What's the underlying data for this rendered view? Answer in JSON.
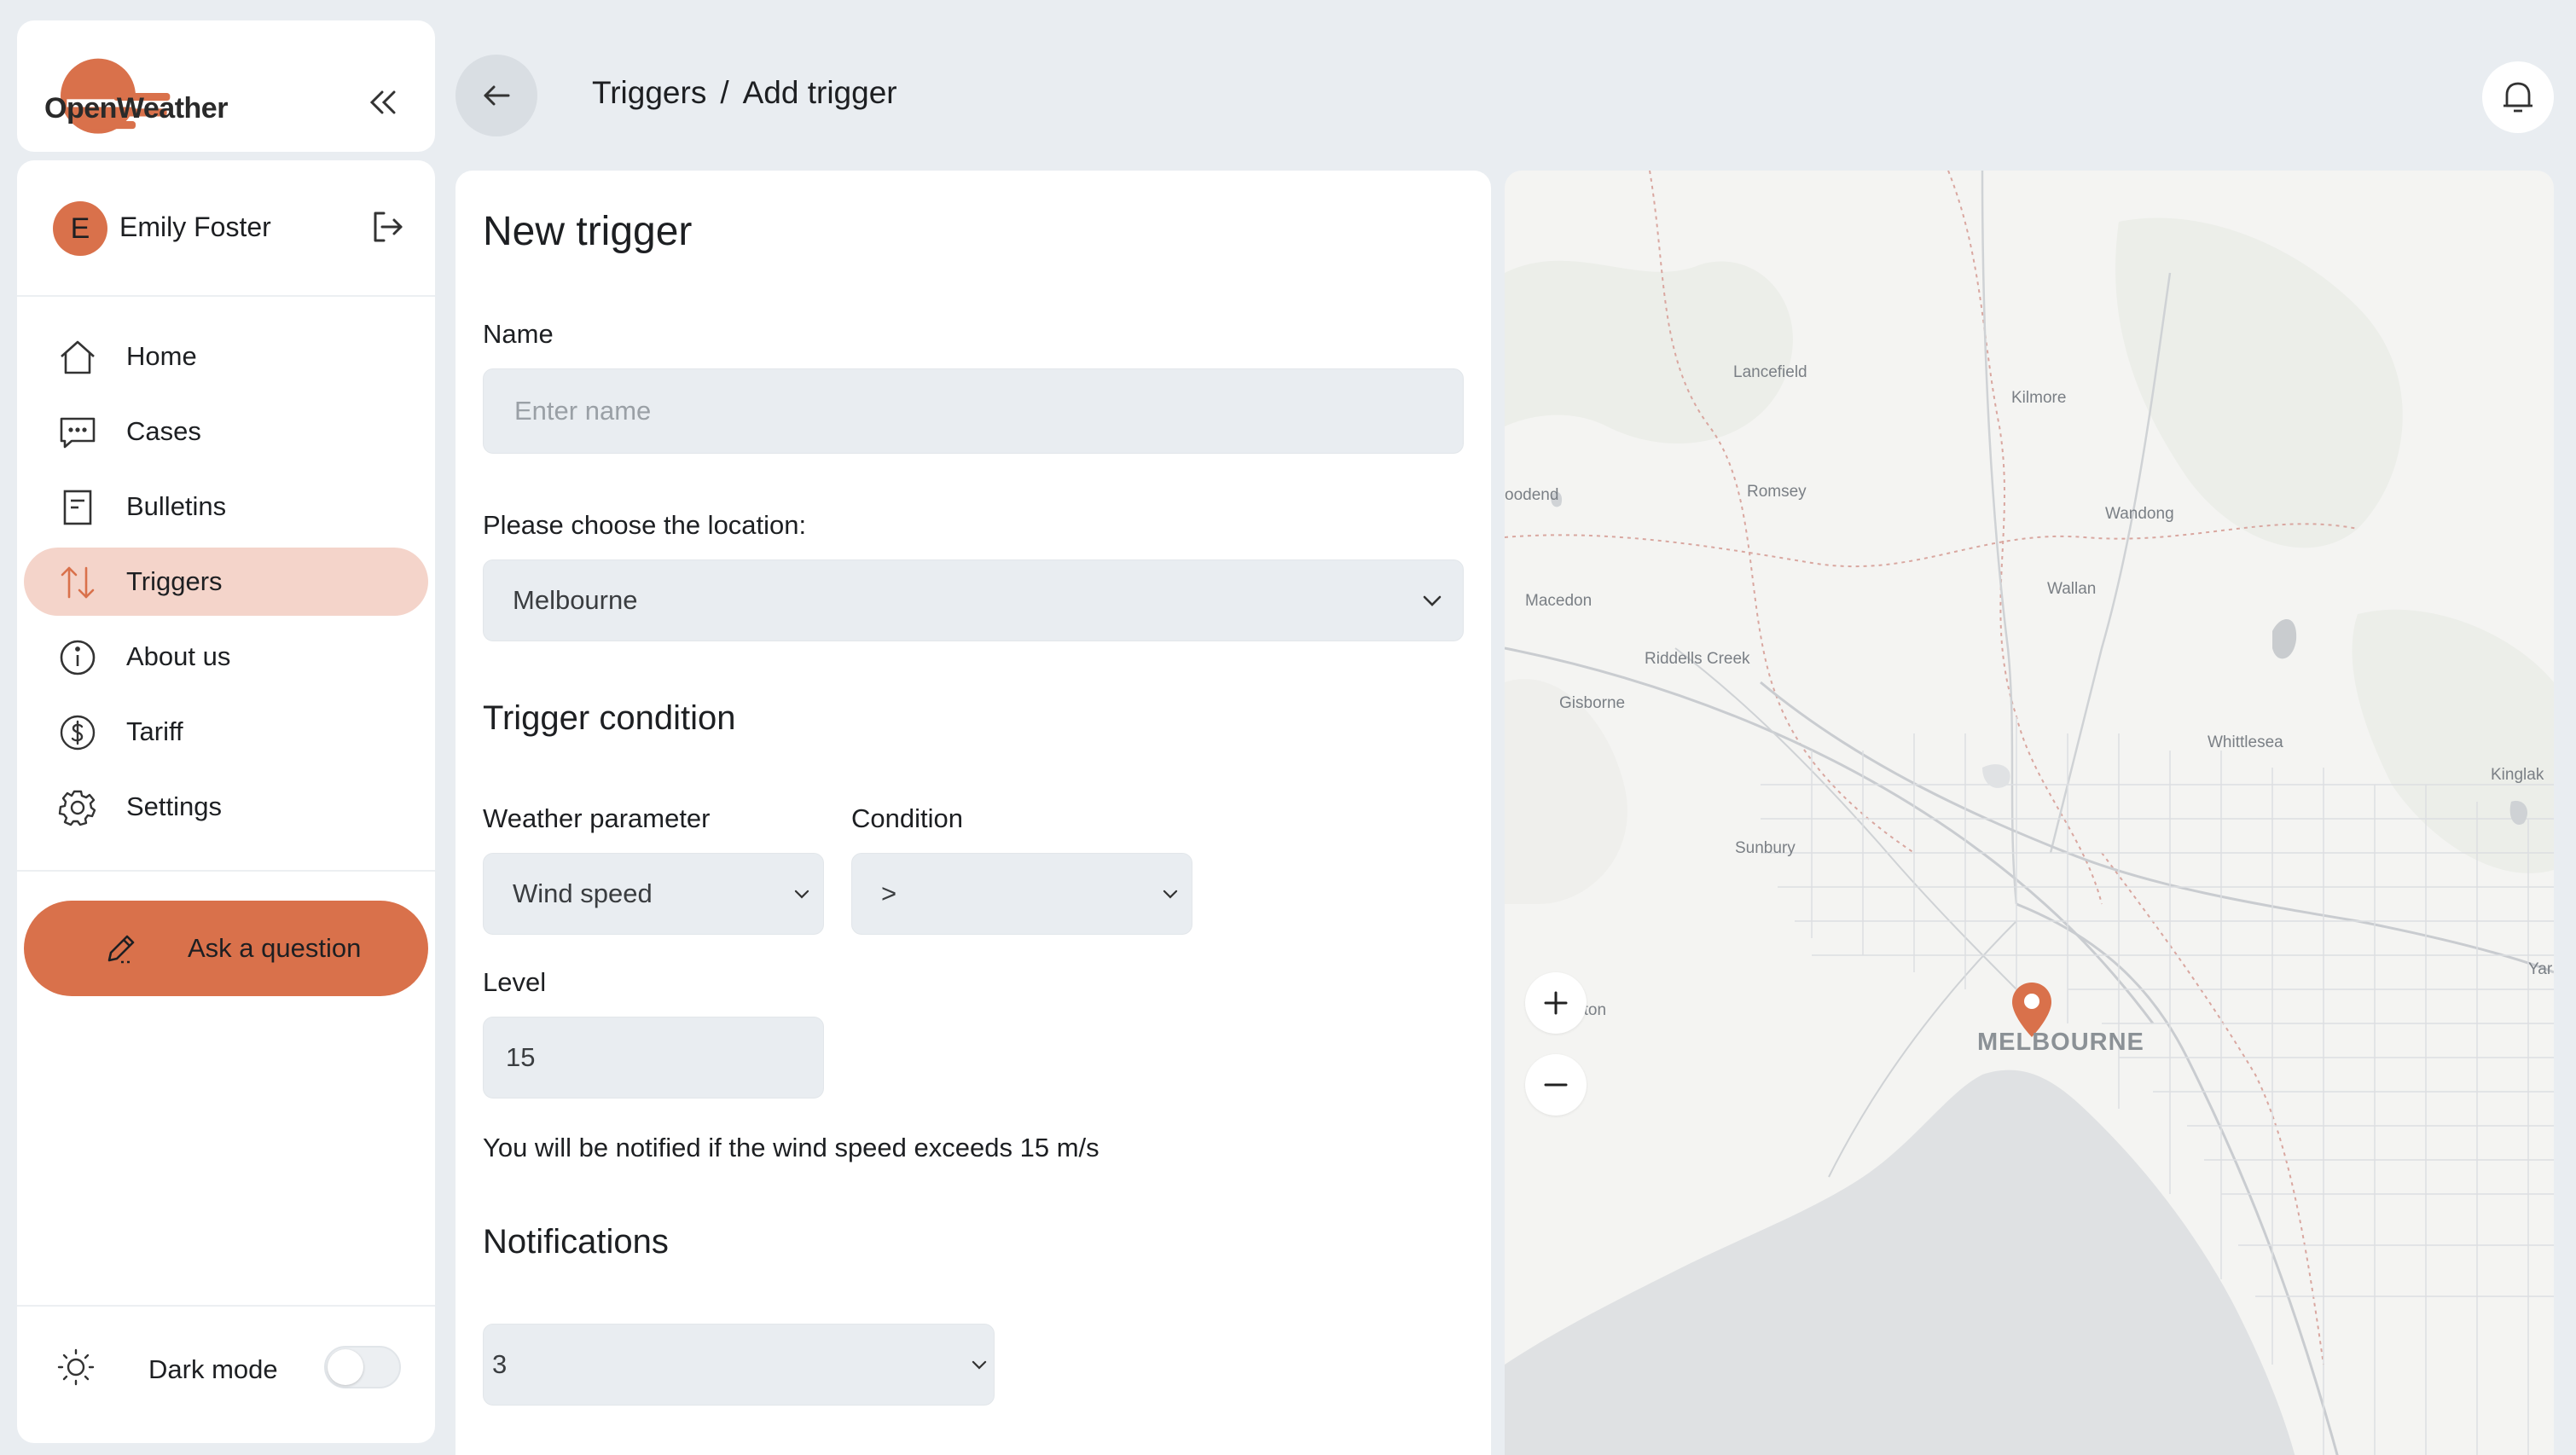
{
  "app": {
    "logo_text": "OpenWeather",
    "accent": "#d9714b"
  },
  "user": {
    "initial": "E",
    "name": "Emily Foster"
  },
  "nav": {
    "items": [
      {
        "label": "Home",
        "icon": "home-icon"
      },
      {
        "label": "Cases",
        "icon": "chat-icon"
      },
      {
        "label": "Bulletins",
        "icon": "document-icon"
      },
      {
        "label": "Triggers",
        "icon": "arrows-up-down-icon",
        "active": true
      },
      {
        "label": "About us",
        "icon": "info-icon"
      },
      {
        "label": "Tariff",
        "icon": "dollar-icon"
      },
      {
        "label": "Settings",
        "icon": "gear-icon"
      }
    ]
  },
  "ask_button": {
    "label": "Ask a question"
  },
  "dark_mode": {
    "label": "Dark mode",
    "enabled": false
  },
  "breadcrumb": {
    "parent": "Triggers",
    "separator": "/",
    "current": "Add trigger"
  },
  "form": {
    "title": "New trigger",
    "name_label": "Name",
    "name_placeholder": "Enter name",
    "name_value": "",
    "location_label": "Please choose the location:",
    "location_value": "Melbourne",
    "condition_heading": "Trigger condition",
    "parameter_label": "Weather parameter",
    "parameter_value": "Wind speed",
    "condition_label": "Condition",
    "condition_value": ">",
    "level_label": "Level",
    "level_value": "15",
    "hint": "You will be notified if the wind speed exceeds 15 m/s",
    "notifications_heading": "Notifications",
    "notifications_value": "3"
  },
  "map": {
    "city_label": "MELBOURNE",
    "places": [
      "Lancefield",
      "Kilmore",
      "oodend",
      "Romsey",
      "Wandong",
      "Macedon",
      "Wallan",
      "Riddells Creek",
      "Gisborne",
      "Whittlesea",
      "Kinglak",
      "Sunbury",
      "Yar",
      "Melton"
    ],
    "zoom_in_label": "+",
    "zoom_out_label": "−"
  }
}
